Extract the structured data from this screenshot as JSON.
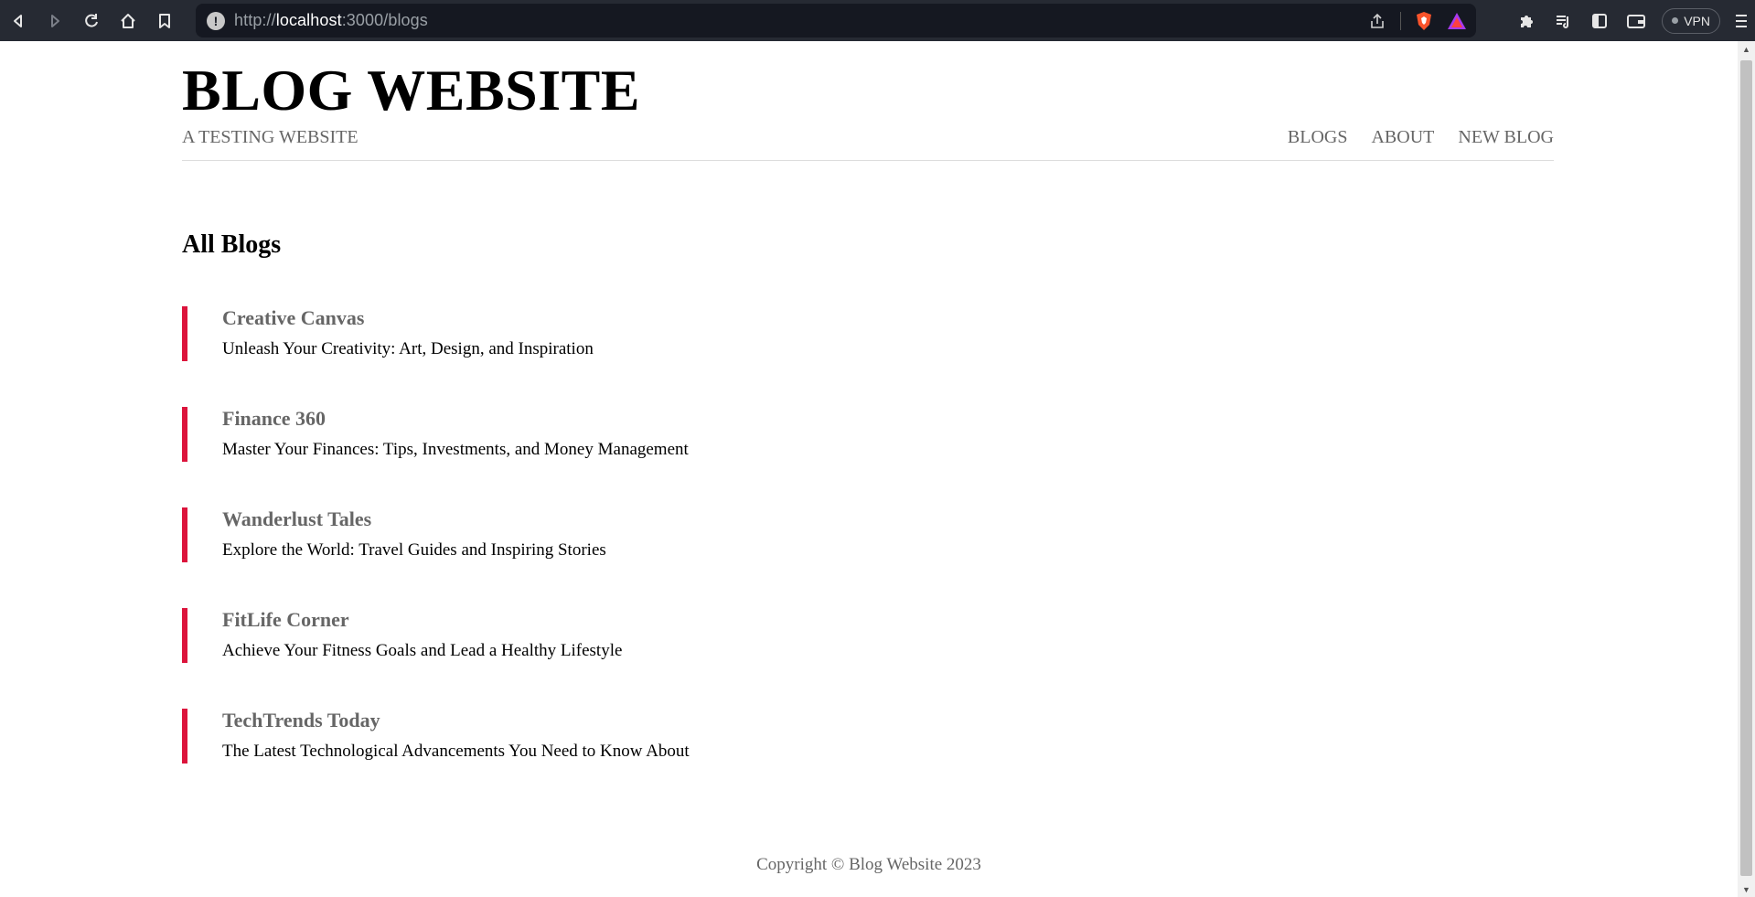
{
  "browser": {
    "url_prefix": "http://",
    "url_host": "localhost",
    "url_rest": ":3000/blogs",
    "vpn_label": "VPN"
  },
  "header": {
    "title": "BLOG WEBSITE",
    "subtitle": "A TESTING WEBSITE",
    "nav": [
      "BLOGS",
      "ABOUT",
      "NEW BLOG"
    ]
  },
  "main": {
    "section_title": "All Blogs",
    "blogs": [
      {
        "title": "Creative Canvas",
        "snippet": "Unleash Your Creativity: Art, Design, and Inspiration"
      },
      {
        "title": "Finance 360",
        "snippet": "Master Your Finances: Tips, Investments, and Money Management"
      },
      {
        "title": "Wanderlust Tales",
        "snippet": "Explore the World: Travel Guides and Inspiring Stories"
      },
      {
        "title": "FitLife Corner",
        "snippet": "Achieve Your Fitness Goals and Lead a Healthy Lifestyle"
      },
      {
        "title": "TechTrends Today",
        "snippet": "The Latest Technological Advancements You Need to Know About"
      }
    ]
  },
  "footer": {
    "copyright": "Copyright © Blog Website 2023"
  },
  "colors": {
    "accent": "#dc143c",
    "chrome_bg": "#262a33"
  }
}
